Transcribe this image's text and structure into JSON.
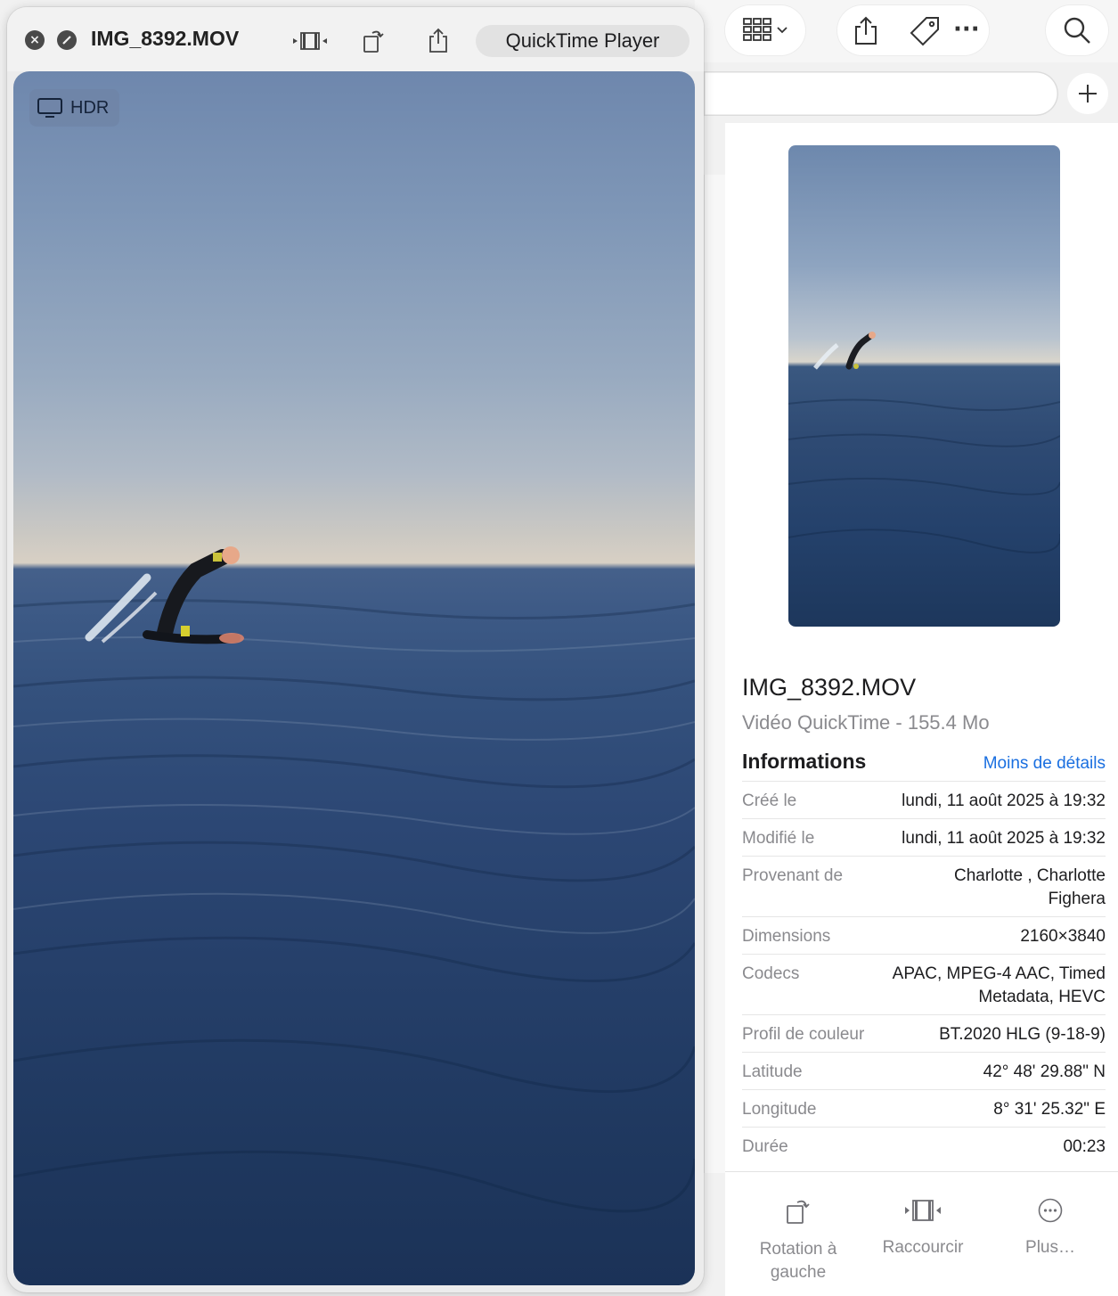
{
  "preview_window": {
    "filename": "IMG_8392.MOV",
    "open_with_label": "QuickTime Player",
    "hdr_badge": "HDR"
  },
  "info_panel": {
    "file_name": "IMG_8392.MOV",
    "file_type": "Vidéo QuickTime - 155.4 Mo",
    "section_title": "Informations",
    "toggle_details_link": "Moins de détails",
    "rows": [
      {
        "label": "Créé le",
        "value": "lundi, 11 août 2025 à 19:32"
      },
      {
        "label": "Modifié le",
        "value": "lundi, 11 août 2025 à 19:32"
      },
      {
        "label": "Provenant de",
        "value": "Charlotte , Charlotte Fighera"
      },
      {
        "label": "Dimensions",
        "value": "2160×3840"
      },
      {
        "label": "Codecs",
        "value": "APAC, MPEG-4 AAC, Timed Metadata, HEVC"
      },
      {
        "label": "Profil de couleur",
        "value": "BT.2020 HLG (9-18-9)"
      },
      {
        "label": "Latitude",
        "value": "42° 48' 29.88\" N"
      },
      {
        "label": "Longitude",
        "value": "8° 31' 25.32\" E"
      },
      {
        "label": "Durée",
        "value": "00:23"
      }
    ],
    "actions": [
      {
        "label": "Rotation à gauche",
        "icon": "rotate-left-icon"
      },
      {
        "label": "Raccourcir",
        "icon": "trim-icon"
      },
      {
        "label": "Plus…",
        "icon": "more-circle-icon"
      }
    ]
  },
  "finder_toolbar": {
    "icons": [
      "view-options-icon",
      "share-icon",
      "tag-icon",
      "more-icon",
      "search-icon",
      "plus-icon"
    ]
  }
}
